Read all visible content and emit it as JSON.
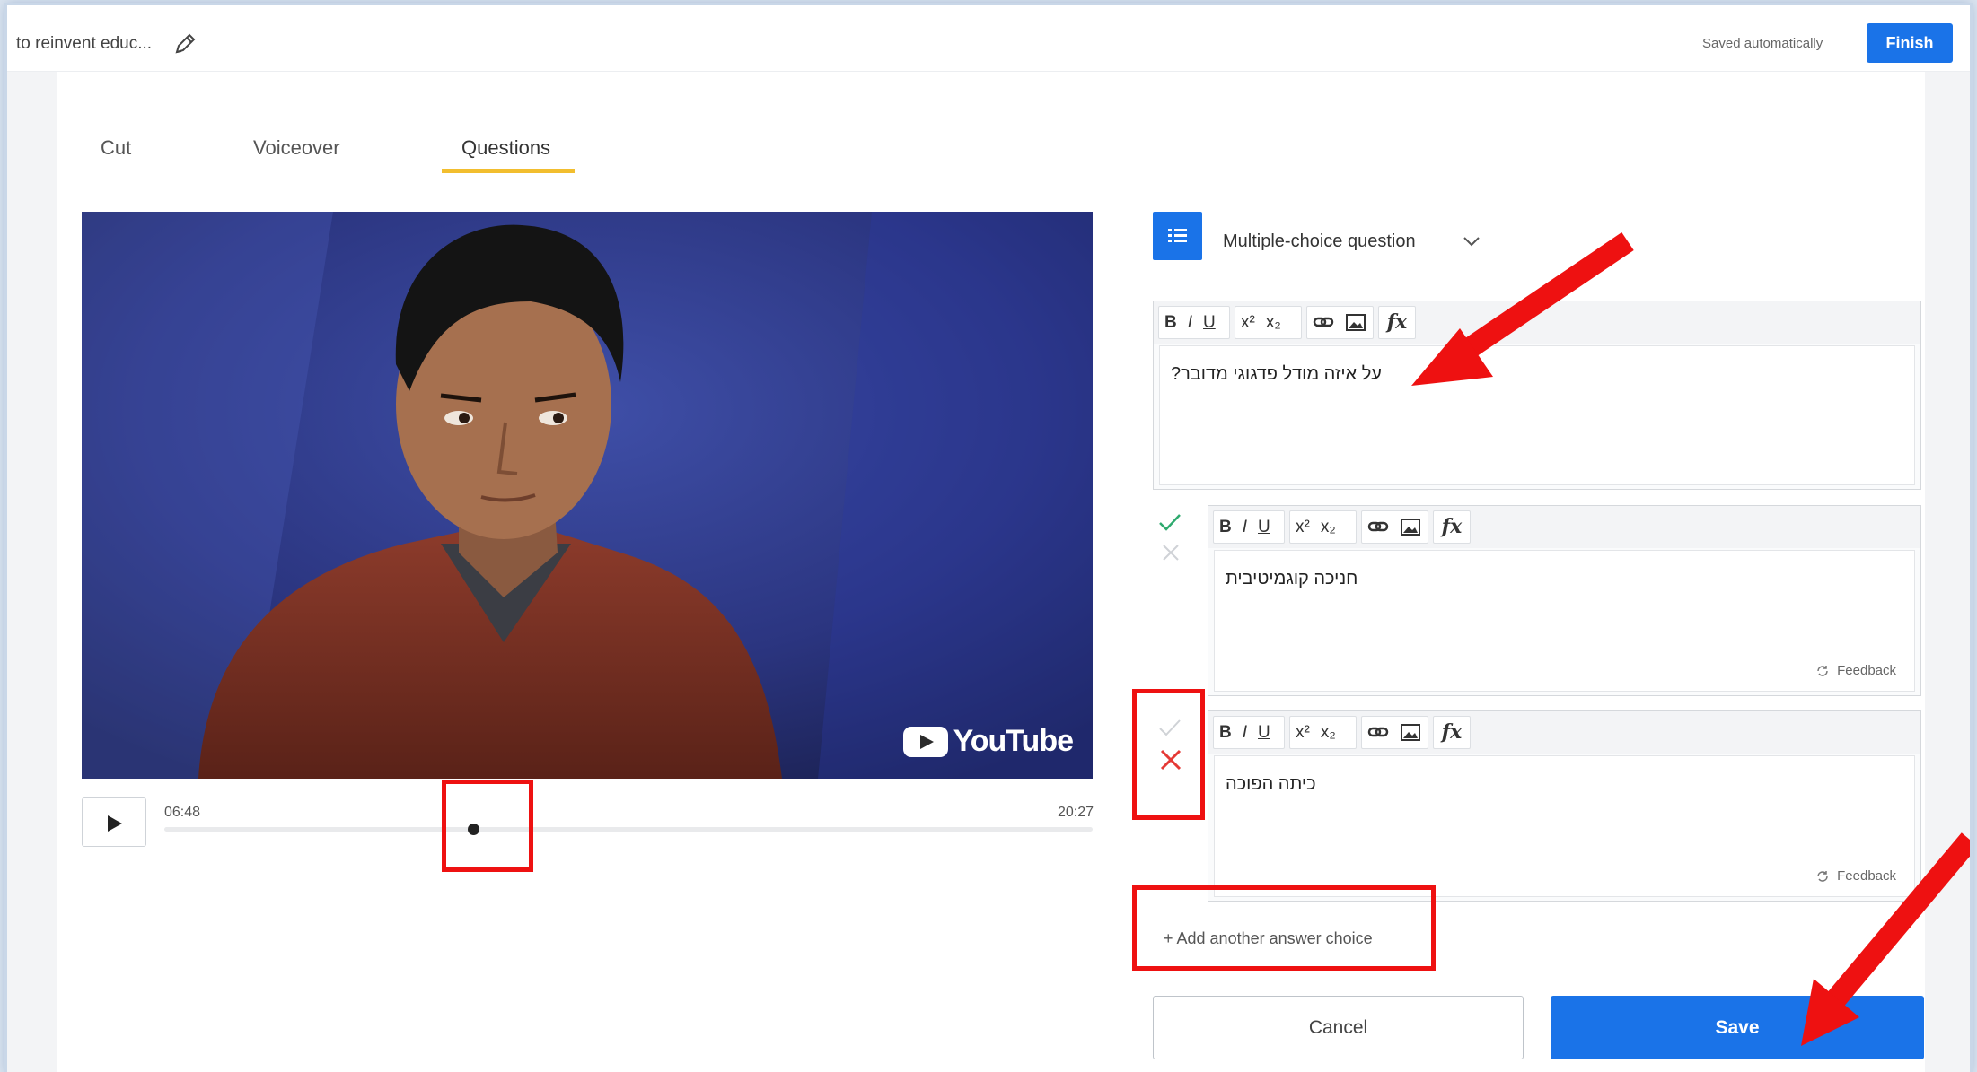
{
  "header": {
    "doc_title": "to reinvent educ...",
    "save_status": "Saved automatically",
    "finish_label": "Finish"
  },
  "tabs": [
    {
      "label": "Cut",
      "active": false
    },
    {
      "label": "Voiceover",
      "active": false
    },
    {
      "label": "Questions",
      "active": true
    }
  ],
  "video": {
    "brand": "YouTube",
    "current_time": "06:48",
    "total_time": "20:27",
    "progress": 0.333
  },
  "question": {
    "type_label": "Multiple-choice question",
    "text": "על איזה מודל פדגוגי מדובר?"
  },
  "answers": [
    {
      "text": "חניכה קוגמיטיבית",
      "correct": true,
      "feedback_label": "Feedback"
    },
    {
      "text": "כיתה הפוכה",
      "correct": false,
      "feedback_label": "Feedback"
    }
  ],
  "toolbar": {
    "bold": "B",
    "italic": "I",
    "underline": "U",
    "superscript": "x²",
    "subscript": "x₂",
    "formula": "fx"
  },
  "actions": {
    "add_choice": "+ Add another answer choice",
    "cancel": "Cancel",
    "save": "Save"
  },
  "colors": {
    "accent": "#1a73e8",
    "tab_underline": "#f2be2f",
    "correct_mark": "#2eaa6e",
    "wrong_mark": "#e53935",
    "annotation": "#ee1111"
  }
}
